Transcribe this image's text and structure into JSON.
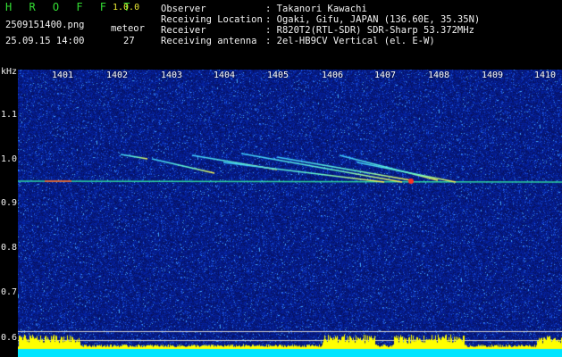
{
  "header": {
    "brand": "H R O F F T",
    "version": "1.0.0",
    "filename": "2509151400.png",
    "datetime": "25.09.15 14:00",
    "meteor_label": "meteor",
    "meteor_count": "27",
    "observer_label": "Observer",
    "observer_value": ": Takanori Kawachi",
    "location_label": "Receiving Location",
    "location_value": ": Ogaki, Gifu, JAPAN (136.60E, 35.35N)",
    "receiver_label": "Receiver",
    "receiver_value": ": R820T2(RTL-SDR) SDR-Sharp 53.372MHz",
    "antenna_label": "Receiving antenna",
    "antenna_value": ": 2el-HB9CV Vertical (el. E-W)"
  },
  "y_axis": {
    "unit": "kHz",
    "ticks": [
      "1.1",
      "1.0",
      "0.9",
      "0.8",
      "0.7",
      "0.6"
    ]
  },
  "x_axis": {
    "ticks": [
      "1401",
      "1402",
      "1403",
      "1404",
      "1405",
      "1406",
      "1407",
      "1408",
      "1409",
      "1410"
    ]
  },
  "colors": {
    "background_noise": "#0a1a8a",
    "carrier": "#33cc66",
    "brand": "#33dd33",
    "version": "#eaea33",
    "bar_fill": "#ffff00",
    "bar_base": "#00e5ff"
  }
}
